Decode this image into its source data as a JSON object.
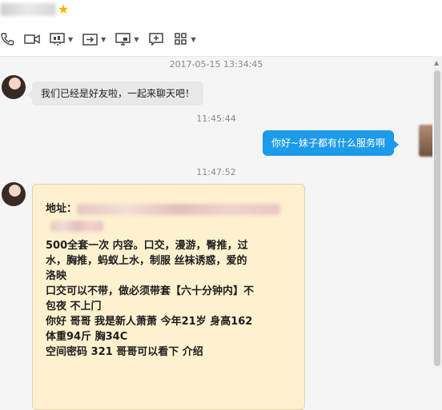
{
  "header": {
    "toolbar": [
      {
        "name": "phone-icon",
        "has_menu": false
      },
      {
        "name": "video-icon",
        "has_menu": false
      },
      {
        "name": "screen-share-icon",
        "has_menu": true
      },
      {
        "name": "file-transfer-icon",
        "has_menu": true
      },
      {
        "name": "remote-desktop-icon",
        "has_menu": true
      },
      {
        "name": "add-chat-icon",
        "has_menu": false
      },
      {
        "name": "apps-icon",
        "has_menu": true
      }
    ]
  },
  "chat": {
    "timestamps": [
      "2017-05-15 13:34:45",
      "11:45:44",
      "11:47:52"
    ],
    "messages": {
      "first": "我们已经是好友啦，一起来聊天吧！",
      "reply": "你好~妹子都有什么服务啊"
    },
    "card": {
      "address_label": "地址：",
      "lines": [
        "500全套一次 内容。口交，漫游，臀推，过",
        "水，胸推，蚂蚁上水，制服 丝袜诱惑，爱的",
        "洛映",
        "口交可以不带，做必须带套【六十分钟内】不",
        "包夜 不上门",
        "你好 哥哥 我是新人萧萧 今年21岁  身高162",
        "体重94斤 胸34C",
        "空间密码  321 哥哥可以看下 介绍"
      ]
    }
  },
  "colors": {
    "reply_bubble": "#1e9be8",
    "incoming_bubble": "#e8e8e8",
    "card_background": "#fdf1cf"
  }
}
